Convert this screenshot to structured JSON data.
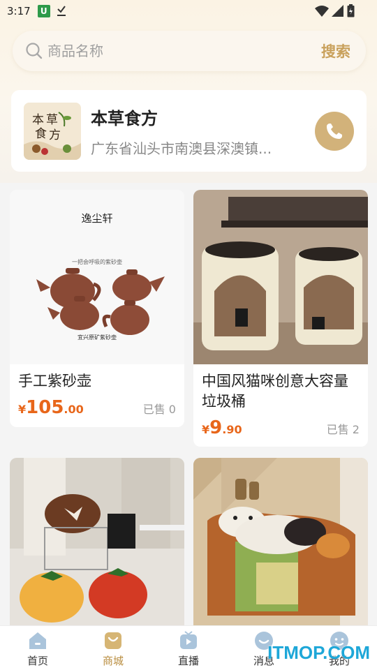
{
  "status_bar": {
    "time": "3:17",
    "app_icon_letter": "U"
  },
  "search": {
    "placeholder": "商品名称",
    "button_label": "搜索"
  },
  "shop": {
    "name": "本草食方",
    "address": "广东省汕头市南澳县深澳镇...",
    "logo_text": "本草食方"
  },
  "products": [
    {
      "title": "手工紫砂壶",
      "price_symbol": "¥",
      "price_int": "105",
      "price_dec": ".00",
      "sold": "已售 0",
      "image_text": [
        "逸尘轩",
        "一把会呼吸的紫砂壶",
        "宜兴原矿紫砂壶"
      ]
    },
    {
      "title": "中国风猫咪创意大容量垃圾桶",
      "price_symbol": "¥",
      "price_int": "9",
      "price_dec": ".90",
      "sold": "已售 2"
    },
    {
      "title": "",
      "image_name": "tomato-cushion-photo"
    },
    {
      "title": "",
      "image_name": "cat-rug-photo"
    }
  ],
  "nav": [
    {
      "label": "首页",
      "icon": "home-icon"
    },
    {
      "label": "商城",
      "icon": "shop-icon",
      "active": true
    },
    {
      "label": "直播",
      "icon": "live-icon"
    },
    {
      "label": "消息",
      "icon": "message-icon"
    },
    {
      "label": "我的",
      "icon": "profile-icon"
    }
  ],
  "watermark": "ITMOP.COM",
  "colors": {
    "accent_gold": "#c9a15c",
    "price_orange": "#e8661a",
    "call_button": "#d2b27a"
  }
}
